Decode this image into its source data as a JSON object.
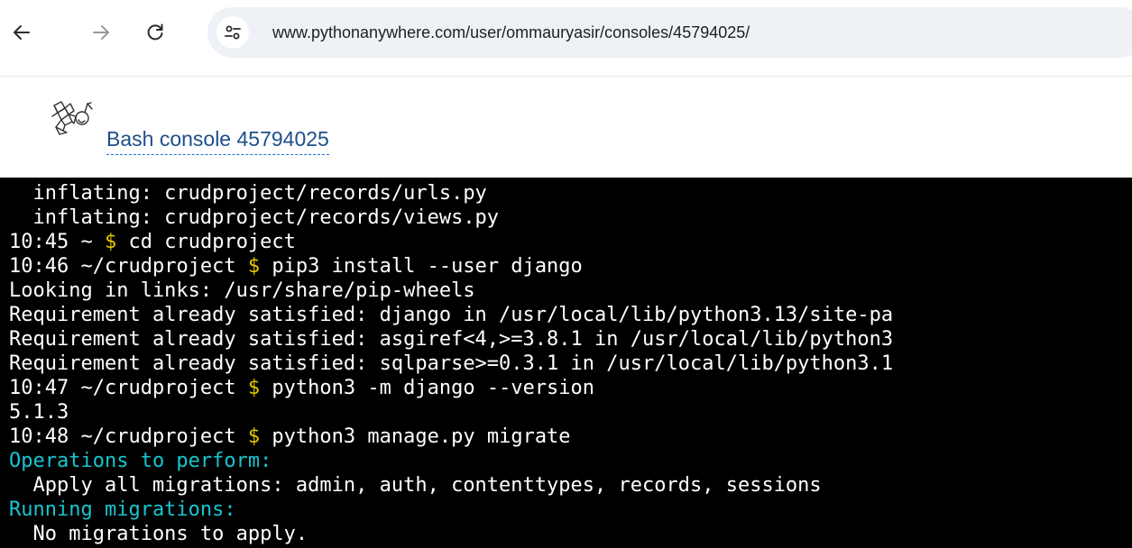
{
  "browser": {
    "url": "www.pythonanywhere.com/user/ommauryasir/consoles/45794025/",
    "icons": {
      "back": "back-arrow-icon",
      "forward": "forward-arrow-icon",
      "reload": "reload-icon",
      "site_info": "tune-icon"
    }
  },
  "page": {
    "title": "Bash console 45794025",
    "logo": "pythonanywhere-logo"
  },
  "terminal": {
    "lines": [
      {
        "text": "  inflating: crudproject/records/urls.py"
      },
      {
        "text": "  inflating: crudproject/records/views.py"
      },
      {
        "time": "10:45",
        "path": "~",
        "cmd": "cd crudproject"
      },
      {
        "time": "10:46",
        "path": "~/crudproject",
        "cmd": "pip3 install --user django"
      },
      {
        "text": "Looking in links: /usr/share/pip-wheels"
      },
      {
        "text": "Requirement already satisfied: django in /usr/local/lib/python3.13/site-pa"
      },
      {
        "text": "Requirement already satisfied: asgiref<4,>=3.8.1 in /usr/local/lib/python3"
      },
      {
        "text": "Requirement already satisfied: sqlparse>=0.3.1 in /usr/local/lib/python3.1"
      },
      {
        "time": "10:47",
        "path": "~/crudproject",
        "cmd": "python3 -m django --version"
      },
      {
        "text": "5.1.3"
      },
      {
        "time": "10:48",
        "path": "~/crudproject",
        "cmd": "python3 manage.py migrate"
      },
      {
        "text": "Operations to perform:",
        "color": "cyan"
      },
      {
        "text": "  Apply all migrations: admin, auth, contenttypes, records, sessions"
      },
      {
        "text": "Running migrations:",
        "color": "cyan"
      },
      {
        "text": "  No migrations to apply."
      }
    ],
    "colors": {
      "background": "#000000",
      "text": "#ffffff",
      "prompt_symbol": "#e4c500",
      "heading": "#18c5d0"
    },
    "prompt_symbol": "$"
  }
}
